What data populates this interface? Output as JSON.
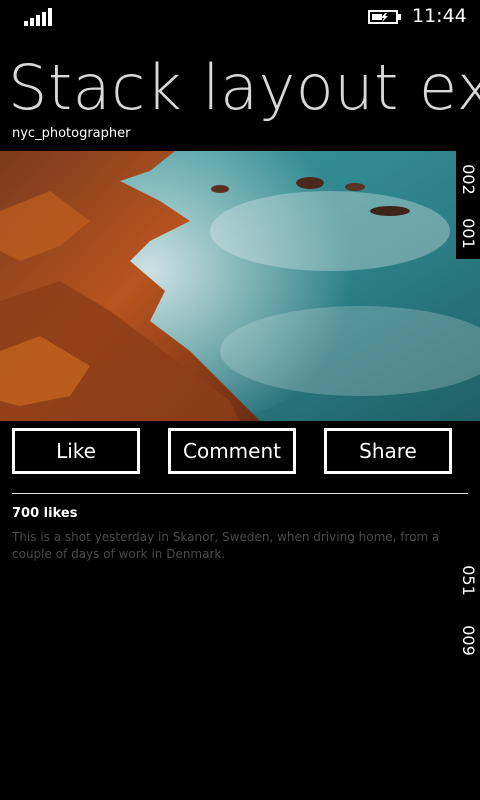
{
  "status_bar": {
    "time": "11:44",
    "signal_icon": "signal-bars-icon",
    "battery_icon": "battery-charging-icon"
  },
  "header": {
    "title": "Stack layout exc",
    "username": "nyc_photographer"
  },
  "photo": {
    "description_icon": "coastal-photo"
  },
  "side_labels": {
    "top_first": "002",
    "top_second": "001",
    "bottom_first": "051",
    "bottom_second": "009"
  },
  "actions": {
    "like_label": "Like",
    "comment_label": "Comment",
    "share_label": "Share"
  },
  "post": {
    "likes": "700 likes",
    "caption": "This is a shot yesterday in Skanor, Sweden, when driving home, from a couple of days of work in Denmark."
  },
  "colors": {
    "background": "#000000",
    "text": "#ffffff",
    "caption_text": "#4a4a4a",
    "sea": "#2f8a8f"
  }
}
